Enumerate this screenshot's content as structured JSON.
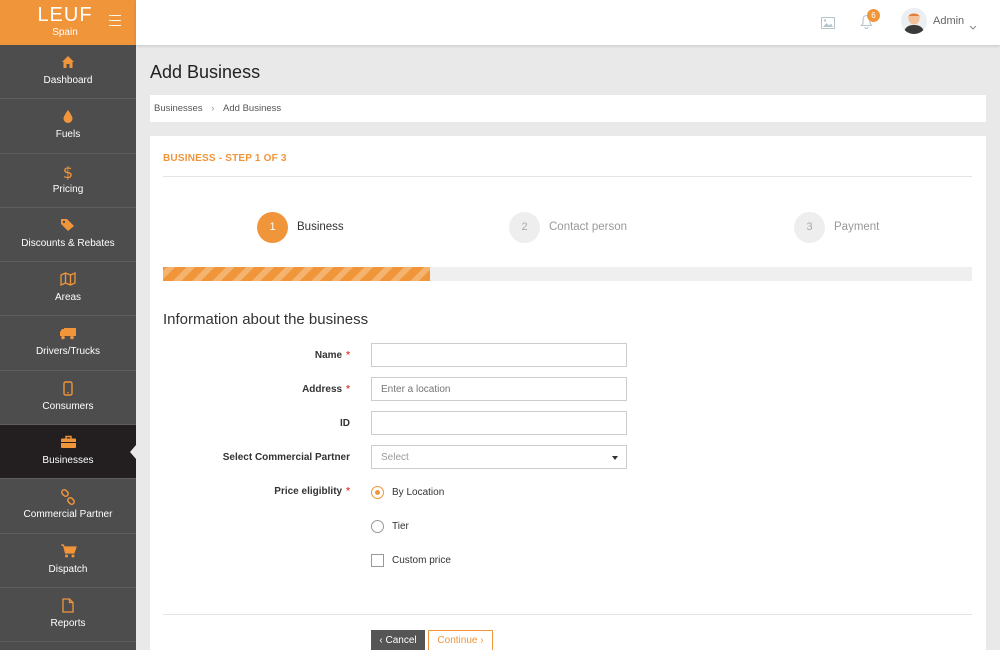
{
  "brand": {
    "title": "LEUF",
    "subtitle": "Spain",
    "accent": "#f0953a"
  },
  "sidebar": {
    "items": [
      {
        "label": "Dashboard",
        "icon": "home-icon"
      },
      {
        "label": "Fuels",
        "icon": "drop-icon"
      },
      {
        "label": "Pricing",
        "icon": "dollar-icon"
      },
      {
        "label": "Discounts & Rebates",
        "icon": "tags-icon"
      },
      {
        "label": "Areas",
        "icon": "map-icon"
      },
      {
        "label": "Drivers/Trucks",
        "icon": "truck-icon"
      },
      {
        "label": "Consumers",
        "icon": "mobile-icon"
      },
      {
        "label": "Businesses",
        "icon": "briefcase-icon",
        "active": true
      },
      {
        "label": "Commercial Partner",
        "icon": "link-icon"
      },
      {
        "label": "Dispatch",
        "icon": "cart-icon"
      },
      {
        "label": "Reports",
        "icon": "file-icon"
      }
    ]
  },
  "topbar": {
    "notification_count": "6",
    "user_name": "Admin"
  },
  "page": {
    "title": "Add Business",
    "breadcrumb": [
      "Businesses",
      "Add Business"
    ]
  },
  "wizard": {
    "step_title": "BUSINESS - STEP 1 OF 3",
    "steps": [
      {
        "num": "1",
        "label": "Business"
      },
      {
        "num": "2",
        "label": "Contact person"
      },
      {
        "num": "3",
        "label": "Payment"
      }
    ],
    "progress": 0.33
  },
  "form": {
    "section_title": "Information about the business",
    "name_label": "Name",
    "address_label": "Address",
    "address_placeholder": "Enter a location",
    "id_label": "ID",
    "partner_label": "Select Commercial Partner",
    "partner_value": "Select",
    "price_label": "Price eligiblity",
    "required_mark": "*",
    "options": {
      "by_location": "By Location",
      "tier": "Tier",
      "custom": "Custom price"
    }
  },
  "buttons": {
    "cancel": "‹ Cancel",
    "continue": "Continue ›"
  }
}
